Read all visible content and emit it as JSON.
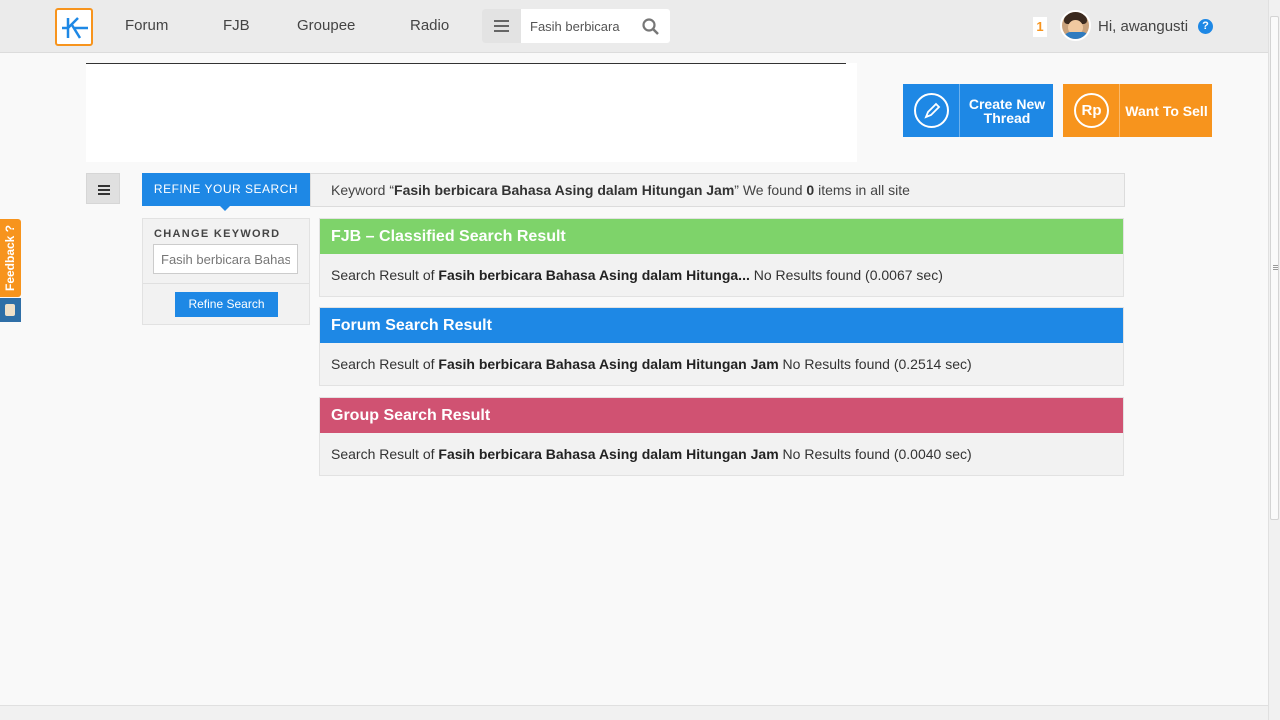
{
  "nav": {
    "items": [
      "Forum",
      "FJB",
      "Groupee",
      "Radio"
    ],
    "search_value": "Fasih berbicara",
    "notification_count": "1",
    "greeting": "Hi, awangusti",
    "help_label": "?"
  },
  "actions": {
    "create_label": "Create New Thread",
    "sell_label": "Want To Sell",
    "sell_icon_text": "Rp"
  },
  "feedback": {
    "label": "Feedback ?"
  },
  "refine": {
    "tab_label": "REFINE YOUR SEARCH",
    "change_keyword_label": "CHANGE KEYWORD",
    "keyword_value": "Fasih berbicara Bahasa Asing dalam Hitungan Jam",
    "button_label": "Refine Search"
  },
  "summary": {
    "prefix": "Keyword “",
    "keyword": "Fasih berbicara Bahasa Asing dalam Hitungan Jam",
    "middle": "” We found ",
    "count": "0",
    "suffix": " items in all site"
  },
  "results": [
    {
      "title": "FJB – Classified Search Result",
      "prefix": "Search Result of ",
      "keyword": "Fasih berbicara Bahasa Asing dalam Hitunga...",
      "status": " No Results found (0.0067 sec)",
      "color": "#7ed36a"
    },
    {
      "title": "Forum Search Result",
      "prefix": "Search Result of ",
      "keyword": "Fasih berbicara Bahasa Asing dalam Hitungan Jam",
      "status": " No Results found (0.2514 sec)",
      "color": "#1e88e5"
    },
    {
      "title": "Group Search Result",
      "prefix": "Search Result of ",
      "keyword": "Fasih berbicara Bahasa Asing dalam Hitungan Jam",
      "status": " No Results found (0.0040 sec)",
      "color": "#d05272"
    }
  ],
  "colors": {
    "accent": "#1e88e5",
    "brand": "#f7941d"
  }
}
